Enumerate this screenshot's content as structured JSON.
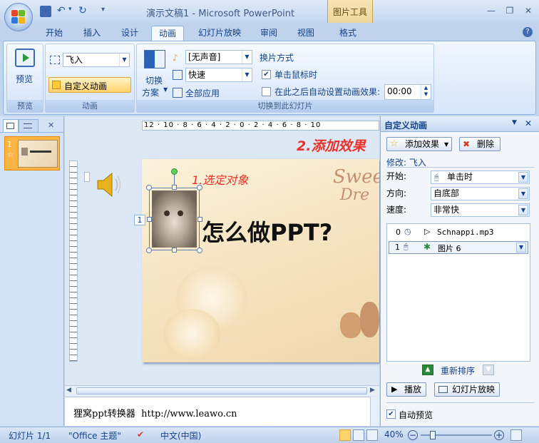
{
  "app": {
    "title": "演示文稿1 - Microsoft PowerPoint",
    "contextual_tab": "图片工具"
  },
  "tabs": [
    "开始",
    "插入",
    "设计",
    "动画",
    "幻灯片放映",
    "审阅",
    "视图",
    "格式"
  ],
  "ribbon": {
    "preview_group": {
      "button": "预览",
      "label": "预览"
    },
    "animation_group": {
      "effect_value": "飞入",
      "custom_button": "自定义动画",
      "label": "动画"
    },
    "transition_group": {
      "switch_label_1": "切换",
      "switch_label_2": "方案",
      "sound_value": "[无声音]",
      "speed_value": "快速",
      "apply_all": "全部应用",
      "advance_title": "换片方式",
      "on_click": "单击鼠标时",
      "auto_after": "在此之后自动设置动画效果:",
      "time_value": "00:00",
      "label": "切换到此幻灯片"
    }
  },
  "slides_pane": {
    "slide_number": "1"
  },
  "slide": {
    "title_text": "怎么做PPT?",
    "annotation_1": "1.选定对象",
    "annotation_2": "2.添加效果",
    "deco_text_1": "Sweet",
    "deco_text_2": "Dre",
    "object_tag": "1"
  },
  "ruler": {
    "labels": [
      "12",
      "10",
      "8",
      "6",
      "4",
      "2",
      "0",
      "2",
      "4",
      "6",
      "8",
      "10"
    ]
  },
  "notes": {
    "text": "狸窝ppt转换器  http://www.leawo.cn"
  },
  "task_pane": {
    "title": "自定义动画",
    "add_effect": "添加效果",
    "delete": "删除",
    "modify_label": "修改: 飞入",
    "start_label": "开始:",
    "start_value": "单击时",
    "direction_label": "方向:",
    "direction_value": "自底部",
    "speed_label": "速度:",
    "speed_value": "非常快",
    "items": [
      {
        "index": "0",
        "name": "Schnappi.mp3"
      },
      {
        "index": "1",
        "name": "图片 6"
      }
    ],
    "reorder": "重新排序",
    "play": "播放",
    "slideshow": "幻灯片放映",
    "auto_preview": "自动预览"
  },
  "status": {
    "slide_info": "幻灯片 1/1",
    "theme": "\"Office 主题\"",
    "language": "中文(中国)",
    "zoom": "40%"
  },
  "colors": {
    "accent": "#15428b",
    "annotation": "#e8322a"
  }
}
